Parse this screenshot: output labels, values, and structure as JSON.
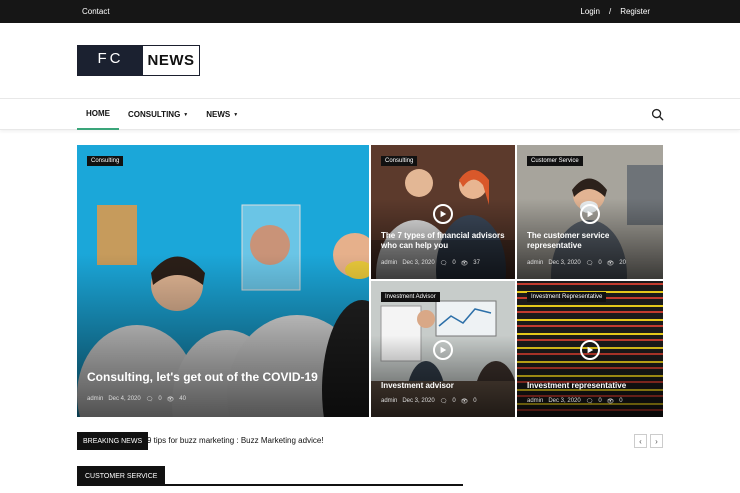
{
  "topbar": {
    "contact": "Contact",
    "login": "Login",
    "separator": "/",
    "register": "Register"
  },
  "logo": {
    "left": "FC",
    "right": "NEWS"
  },
  "nav": {
    "items": [
      {
        "label": "HOME",
        "active": true
      },
      {
        "label": "CONSULTING",
        "dropdown": true
      },
      {
        "label": "NEWS",
        "dropdown": true
      }
    ],
    "search_icon": "search-icon",
    "accent_color": "#3aa57a"
  },
  "tiles": [
    {
      "tag": "Consulting",
      "title": "Consulting, let's get out of the COVID-19",
      "author": "admin",
      "date": "Dec 4, 2020",
      "comments": "0",
      "views": "40"
    },
    {
      "tag": "Consulting",
      "title": "The 7 types of financial advisors who can help you",
      "author": "admin",
      "date": "Dec 3, 2020",
      "comments": "0",
      "views": "37"
    },
    {
      "tag": "Customer Service",
      "title": "The customer service representative",
      "author": "admin",
      "date": "Dec 3, 2020",
      "comments": "0",
      "views": "20"
    },
    {
      "tag": "Investment Advisor",
      "title": "Investment advisor",
      "author": "admin",
      "date": "Dec 3, 2020",
      "comments": "0",
      "views": "0"
    },
    {
      "tag": "Investment Representative",
      "title": "Investment representative",
      "author": "admin",
      "date": "Dec 3, 2020",
      "comments": "0",
      "views": "0"
    }
  ],
  "breaking": {
    "label": "BREAKING NEWS",
    "headline": "9 tips for buzz marketing : Buzz Marketing advice!",
    "prev": "‹",
    "next": "›"
  },
  "section": {
    "label": "CUSTOMER SERVICE"
  }
}
